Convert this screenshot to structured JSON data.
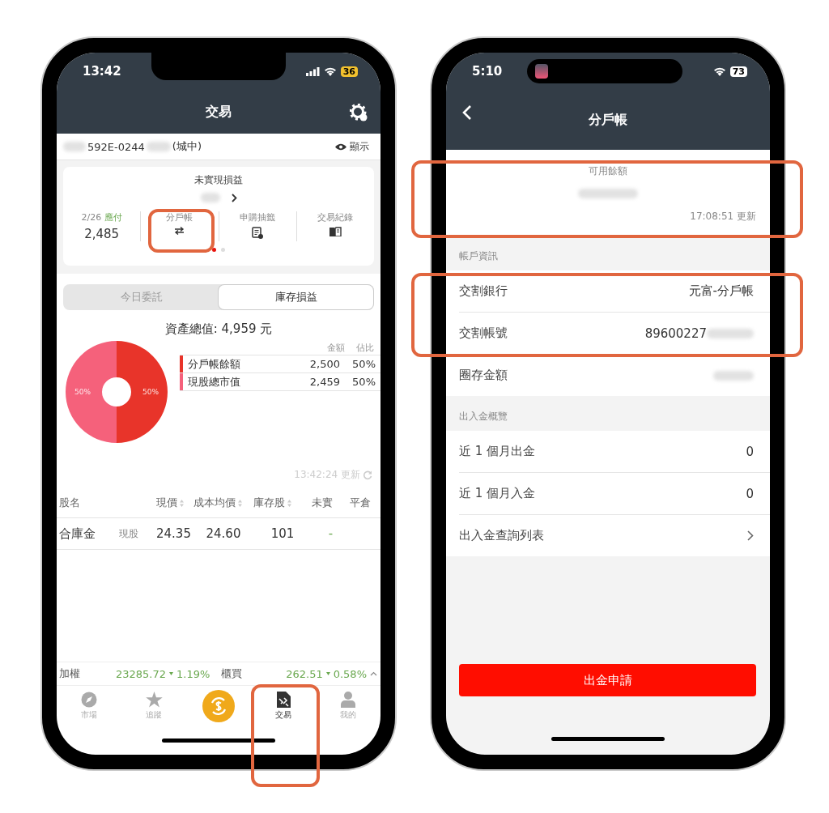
{
  "left_screen": {
    "status_bar": {
      "time": "13:42",
      "battery": "36",
      "low_power": true
    },
    "header": {
      "title": "交易"
    },
    "account": {
      "number": "592E-0244",
      "branch": "(城中)",
      "toggle": "顯示"
    },
    "summary": {
      "title": "未實現損益",
      "items": [
        {
          "kind": "payable",
          "date": "2/26",
          "label": "應付",
          "value": "2,485"
        },
        {
          "kind": "transfer",
          "label": "分戶帳"
        },
        {
          "kind": "subscription",
          "label": "申購抽籤"
        },
        {
          "kind": "history",
          "label": "交易紀錄"
        }
      ],
      "pages": [
        {
          "selected": true
        },
        {
          "selected": false
        }
      ]
    },
    "segments": [
      {
        "label": "今日委託",
        "selected": false
      },
      {
        "label": "庫存損益",
        "selected": true
      }
    ],
    "assets": {
      "total": "資產總值: 4,959 元",
      "chart_data": {
        "type": "donut",
        "categories": [
          "分戶帳餘額",
          "現股總市值"
        ],
        "series": [
          {
            "name": "佔比",
            "values": [
              50,
              50
            ]
          }
        ],
        "value_labels": [
          "50%",
          "50%"
        ]
      },
      "legend": {
        "amount_header": "金額",
        "rows": [
          {
            "amount": "2,500",
            "share": "50%",
            "color": "#e8342a"
          },
          {
            "amount": "2,459",
            "share": "50%",
            "color": "#f5617b"
          }
        ]
      }
    },
    "updated": "13:42:24 更新",
    "holdings": {
      "columns": [
        {
          "label": "股名",
          "sortable": false
        },
        {
          "label": "現價",
          "sortable": true
        },
        {
          "label": "成本均價",
          "sortable": true
        },
        {
          "label": "庫存股",
          "sortable": true
        },
        {
          "label": "未實",
          "sortable": false
        },
        {
          "label": "平倉",
          "sortable": false
        }
      ],
      "rows": [
        {
          "type": "現股",
          "cells": [
            "合庫金",
            "24.35",
            "24.60",
            "101",
            "-"
          ]
        }
      ]
    },
    "indices": [
      {
        "name": "加權",
        "value": "23285.72",
        "change": "1.19%"
      },
      {
        "name": "櫃買",
        "value": "262.51",
        "change": "0.58%"
      }
    ],
    "nav": [
      {
        "kind": "market",
        "label": "市場",
        "selected": false
      },
      {
        "kind": "watch",
        "label": "追蹤",
        "selected": false
      },
      {
        "kind": "center",
        "selected": false
      },
      {
        "kind": "trade",
        "label": "交易",
        "selected": true
      },
      {
        "kind": "me",
        "label": "我的",
        "selected": false
      }
    ]
  },
  "right_screen": {
    "status_bar": {
      "time": "5:10",
      "battery": "73",
      "low_power": false
    },
    "header": {
      "title": "分戶帳"
    },
    "balance": {
      "label": "可用餘額",
      "updated": "17:08:51 更新"
    },
    "sections": [
      {
        "title": "帳戶資訊",
        "rows": [
          {
            "kind": "value",
            "label": "交割銀行",
            "value": "元富-分戶帳",
            "redacted": false
          },
          {
            "kind": "value",
            "label": "交割帳號",
            "value": "89600227",
            "redacted": true
          },
          {
            "kind": "value",
            "label": "圈存金額",
            "redacted": true
          }
        ]
      },
      {
        "title": "出入金概覽",
        "rows": [
          {
            "kind": "value",
            "label": "近 1 個月出金",
            "value": "0",
            "redacted": false
          },
          {
            "kind": "value",
            "label": "近 1 個月入金",
            "value": "0",
            "redacted": false
          },
          {
            "kind": "link",
            "label": "出入金查詢列表"
          }
        ]
      }
    ],
    "button": "出金申請"
  }
}
